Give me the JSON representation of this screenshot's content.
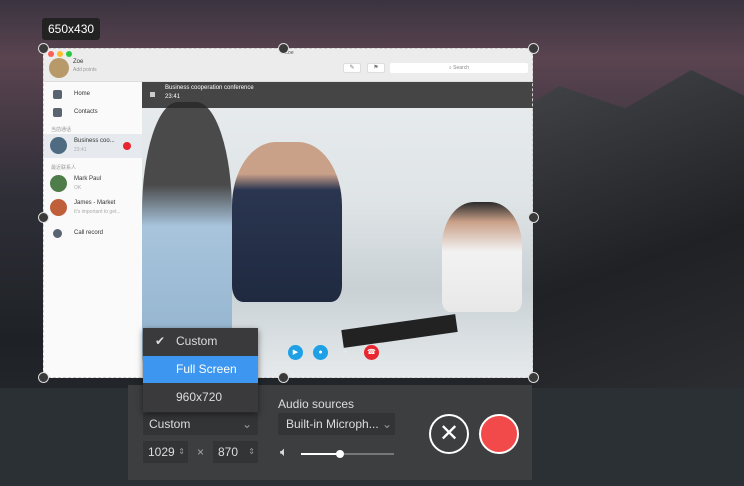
{
  "selection": {
    "size_label": "650x430"
  },
  "app": {
    "title_text": "Zoe",
    "user": {
      "name": "Zoe",
      "status": "Add points"
    },
    "toolbar": {
      "compose_icon": "compose-icon",
      "pin_icon": "pin-icon",
      "search_placeholder": "Search"
    },
    "sidebar": {
      "nav": [
        {
          "label": "Home",
          "icon": "home-icon"
        },
        {
          "label": "Contacts",
          "icon": "contacts-icon"
        }
      ],
      "section_current": "当前通话",
      "current_call": {
        "name": "Business coo...",
        "time": "23:41"
      },
      "section_recent": "最近联系人",
      "recent": [
        {
          "name": "Mark Paul",
          "message": "OK"
        },
        {
          "name": "James - Market",
          "message": "It's important to get..."
        }
      ],
      "call_record": "Call record"
    },
    "call": {
      "title": "Business cooperation conference",
      "time": "23:41"
    }
  },
  "recorder": {
    "size_menu": {
      "options": [
        "Custom",
        "Full Screen",
        "960x720"
      ],
      "checked": "Custom",
      "highlighted": "Full Screen"
    },
    "size_select": "Custom",
    "width": "1029",
    "height": "870",
    "times": "×",
    "audio_label": "Audio sources",
    "audio_select": "Built-in Microph...",
    "volume": 0.42,
    "colors": {
      "record": "#f2494a",
      "highlight": "#3d97f0"
    }
  }
}
